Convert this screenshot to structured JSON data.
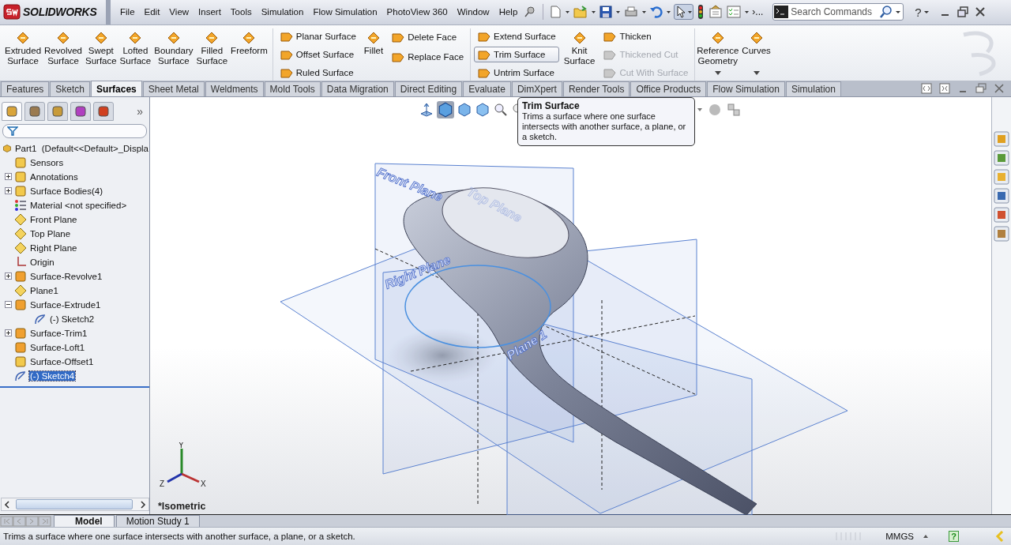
{
  "app": {
    "logo": "SOLIDWORKS"
  },
  "menu": [
    "File",
    "Edit",
    "View",
    "Insert",
    "Tools",
    "Simulation",
    "Flow Simulation",
    "PhotoView 360",
    "Window",
    "Help"
  ],
  "quick_toolbar": {
    "overflow": "›..."
  },
  "search": {
    "placeholder": "Search Commands"
  },
  "help_button": "?",
  "ribbon": [
    {
      "kind": "large",
      "items": [
        {
          "label": "Extruded Surface",
          "dropdown": false
        },
        {
          "label": "Revolved Surface",
          "dropdown": false
        },
        {
          "label": "Swept Surface",
          "dropdown": false
        },
        {
          "label": "Lofted Surface",
          "dropdown": false
        },
        {
          "label": "Boundary Surface",
          "dropdown": false
        },
        {
          "label": "Filled Surface",
          "dropdown": false
        },
        {
          "label": "Freeform",
          "dropdown": false
        }
      ]
    },
    {
      "kind": "column",
      "items": [
        {
          "label": "Planar Surface",
          "disabled": false,
          "highlighted": false
        },
        {
          "label": "Offset Surface",
          "disabled": false,
          "highlighted": false
        },
        {
          "label": "Ruled Surface",
          "disabled": false,
          "highlighted": false
        }
      ]
    },
    {
      "kind": "large",
      "items": [
        {
          "label": "Fillet",
          "dropdown": false
        }
      ]
    },
    {
      "kind": "column",
      "items": [
        {
          "label": "Delete Face",
          "disabled": false,
          "highlighted": false
        },
        {
          "label": "Replace Face",
          "disabled": false,
          "highlighted": false
        }
      ]
    },
    {
      "kind": "column",
      "items": [
        {
          "label": "Extend Surface",
          "disabled": false,
          "highlighted": false
        },
        {
          "label": "Trim Surface",
          "disabled": false,
          "highlighted": true
        },
        {
          "label": "Untrim Surface",
          "disabled": false,
          "highlighted": false
        }
      ]
    },
    {
      "kind": "large",
      "items": [
        {
          "label": "Knit Surface",
          "dropdown": false
        }
      ]
    },
    {
      "kind": "column",
      "items": [
        {
          "label": "Thicken",
          "disabled": false,
          "highlighted": false
        },
        {
          "label": "Thickened Cut",
          "disabled": true,
          "highlighted": false
        },
        {
          "label": "Cut With Surface",
          "disabled": true,
          "highlighted": false
        }
      ]
    },
    {
      "kind": "large",
      "items": [
        {
          "label": "Reference Geometry",
          "dropdown": true
        },
        {
          "label": "Curves",
          "dropdown": true
        }
      ]
    }
  ],
  "tabs": [
    {
      "label": "Features",
      "selected": false
    },
    {
      "label": "Sketch",
      "selected": false
    },
    {
      "label": "Surfaces",
      "selected": true
    },
    {
      "label": "Sheet Metal",
      "selected": false
    },
    {
      "label": "Weldments",
      "selected": false
    },
    {
      "label": "Mold Tools",
      "selected": false
    },
    {
      "label": "Data Migration",
      "selected": false
    },
    {
      "label": "Direct Editing",
      "selected": false
    },
    {
      "label": "Evaluate",
      "selected": false
    },
    {
      "label": "DimXpert",
      "selected": false
    },
    {
      "label": "Render Tools",
      "selected": false
    },
    {
      "label": "Office Products",
      "selected": false
    },
    {
      "label": "Flow Simulation",
      "selected": false
    },
    {
      "label": "Simulation",
      "selected": false
    }
  ],
  "panel_tabs": [
    {
      "kind": "tree",
      "selected": true
    },
    {
      "kind": "property",
      "selected": false
    },
    {
      "kind": "config",
      "selected": false
    },
    {
      "kind": "dimension",
      "selected": false
    },
    {
      "kind": "display",
      "selected": false
    }
  ],
  "panel_more": "»",
  "feature_tree": {
    "label": "Part1  (Default<<Default>_Displa",
    "kind": "part",
    "children": [
      {
        "label": "Sensors",
        "kind": "box",
        "selected": false
      },
      {
        "label": "Annotations",
        "kind": "box",
        "selected": false,
        "expanded": false
      },
      {
        "label": "Surface Bodies(4)",
        "kind": "box",
        "selected": false,
        "expanded": false
      },
      {
        "label": "Material <not specified>",
        "kind": "list",
        "selected": false
      },
      {
        "label": "Front Plane",
        "kind": "plane",
        "selected": false
      },
      {
        "label": "Top Plane",
        "kind": "plane",
        "selected": false
      },
      {
        "label": "Right Plane",
        "kind": "plane",
        "selected": false
      },
      {
        "label": "Origin",
        "kind": "origin",
        "selected": false
      },
      {
        "label": "Surface-Revolve1",
        "kind": "feature",
        "selected": false,
        "expanded": false
      },
      {
        "label": "Plane1",
        "kind": "plane",
        "selected": false
      },
      {
        "label": "Surface-Extrude1",
        "kind": "feature",
        "selected": false,
        "expanded": true,
        "children": [
          {
            "label": "(-) Sketch2",
            "kind": "sketch",
            "selected": false
          }
        ]
      },
      {
        "label": "Surface-Trim1",
        "kind": "feature",
        "selected": false,
        "expanded": false
      },
      {
        "label": "Surface-Loft1",
        "kind": "feature",
        "selected": false
      },
      {
        "label": "Surface-Offset1",
        "kind": "box",
        "selected": false
      },
      {
        "label": "(-) Sketch4",
        "kind": "sketch",
        "selected": true
      }
    ]
  },
  "viewport": {
    "plane_labels": [
      "Front Plane",
      "Top Plane",
      "Right Plane",
      "Plane 1"
    ],
    "triad": [
      "Y",
      "Z",
      "X"
    ],
    "view_name": "*Isometric"
  },
  "tooltip": {
    "title": "Trim Surface",
    "text": "Trims a surface where one surface intersects with another surface, a plane, or a sketch."
  },
  "bottom_tabs": [
    {
      "label": "Model",
      "selected": true
    },
    {
      "label": "Motion Study 1",
      "selected": false
    }
  ],
  "status_bar": {
    "message": "Trims a surface where one surface intersects with another surface, a plane, or a sketch.",
    "units": "MMGS",
    "help": "?"
  }
}
